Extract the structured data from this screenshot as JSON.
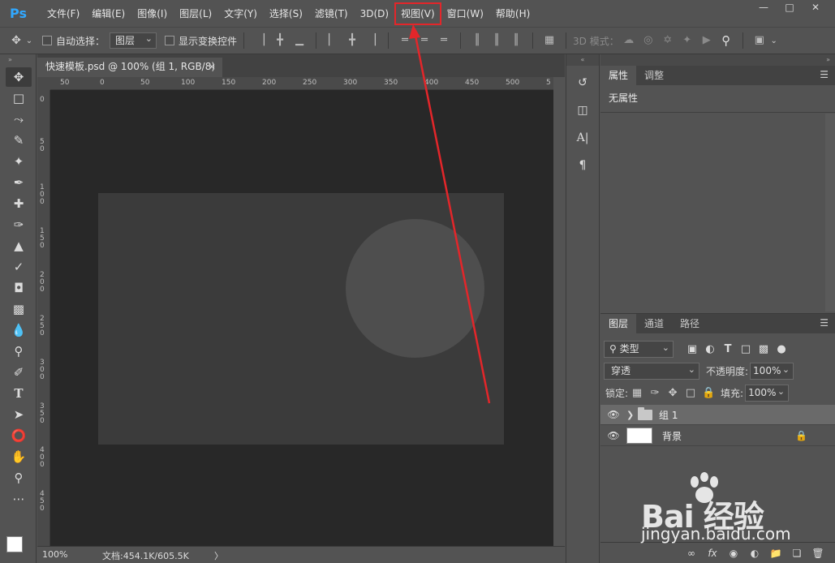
{
  "app": {
    "logo": "Ps"
  },
  "menu": {
    "items": [
      "文件(F)",
      "编辑(E)",
      "图像(I)",
      "图层(L)",
      "文字(Y)",
      "选择(S)",
      "滤镜(T)",
      "3D(D)",
      "视图(V)",
      "窗口(W)",
      "帮助(H)"
    ],
    "highlighted": "视图(V)",
    "highlight_color": "#e3262a"
  },
  "window_controls": [
    "minimize-icon",
    "restore-icon",
    "close-icon"
  ],
  "options_bar": {
    "auto_select_label": "自动选择：",
    "auto_select_value": "图层",
    "show_transform_label": "显示变换控件",
    "mode_3d_label": "3D 模式："
  },
  "document": {
    "tab_title": "快速模板.psd @ 100% (组 1, RGB/8)",
    "tab_close": "×",
    "ruler_h_labels": [
      "50",
      "0",
      "50",
      "100",
      "150",
      "200",
      "250",
      "300",
      "350",
      "400",
      "450",
      "500",
      "5"
    ],
    "ruler_v_labels": [
      "0",
      "5 0",
      "1 0 0",
      "1 5 0",
      "2 0 0",
      "2 5 0",
      "3 0 0",
      "3 5 0",
      "4 0 0",
      "4 5 0"
    ],
    "canvas_bg": "#282828",
    "doc_bg": "#3b3b3b",
    "circle_color": "#4e4e4e"
  },
  "status": {
    "zoom": "100%",
    "doc_info": "文档:454.1K/605.5K",
    "arrow": "〉"
  },
  "tools": [
    "move-icon",
    "marquee-icon",
    "lasso-icon",
    "quick-select-icon",
    "crop-icon",
    "eyedropper-icon",
    "healing-icon",
    "brush-icon",
    "stamp-icon",
    "history-brush-icon",
    "eraser-icon",
    "gradient-icon",
    "blur-icon",
    "dodge-icon",
    "pen-icon",
    "type-icon",
    "path-select-icon",
    "ellipse-icon",
    "hand-icon",
    "zoom-icon",
    "more-icon"
  ],
  "properties_panel": {
    "tabs": [
      "属性",
      "调整"
    ],
    "content": "无属性"
  },
  "layers_panel": {
    "tabs": [
      "图层",
      "通道",
      "路径"
    ],
    "filter_type": "类型",
    "blend_mode": "穿透",
    "opacity_label": "不透明度:",
    "opacity_value": "100%",
    "lock_label": "锁定:",
    "fill_label": "填充:",
    "fill_value": "100%",
    "layers": [
      {
        "name": "组 1",
        "type": "group",
        "visible": true,
        "selected": true
      },
      {
        "name": "背景",
        "type": "background",
        "visible": true,
        "locked": true
      }
    ]
  },
  "watermark": {
    "brand": "Bai  经验",
    "url": "jingyan.baidu.com"
  }
}
